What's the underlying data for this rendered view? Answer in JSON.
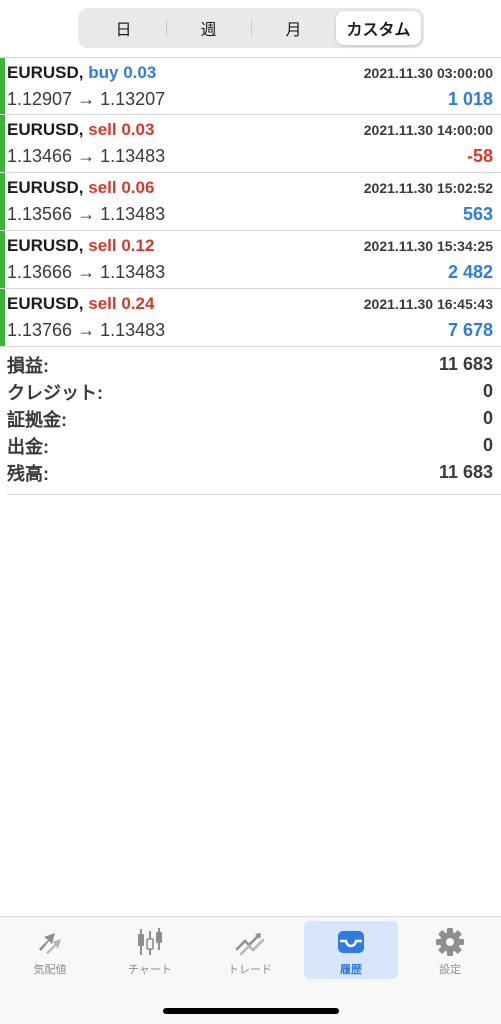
{
  "period_tabs": [
    {
      "label": "日",
      "active": false
    },
    {
      "label": "週",
      "active": false
    },
    {
      "label": "月",
      "active": false
    },
    {
      "label": "カスタム",
      "active": true
    }
  ],
  "deals": [
    {
      "symbol": "EURUSD,",
      "side": "buy 0.03",
      "time": "2021.11.30 03:00:00",
      "prices": "1.12907 → 1.13207",
      "profit": "1 018",
      "profit_sign": "pos"
    },
    {
      "symbol": "EURUSD,",
      "side": "sell 0.03",
      "time": "2021.11.30 14:00:00",
      "prices": "1.13466 → 1.13483",
      "profit": "-58",
      "profit_sign": "neg"
    },
    {
      "symbol": "EURUSD,",
      "side": "sell 0.06",
      "time": "2021.11.30 15:02:52",
      "prices": "1.13566 → 1.13483",
      "profit": "563",
      "profit_sign": "pos"
    },
    {
      "symbol": "EURUSD,",
      "side": "sell 0.12",
      "time": "2021.11.30 15:34:25",
      "prices": "1.13666 → 1.13483",
      "profit": "2 482",
      "profit_sign": "pos"
    },
    {
      "symbol": "EURUSD,",
      "side": "sell 0.24",
      "time": "2021.11.30 16:45:43",
      "prices": "1.13766 → 1.13483",
      "profit": "7 678",
      "profit_sign": "pos"
    }
  ],
  "summary": [
    {
      "label": "損益:",
      "value": "11 683"
    },
    {
      "label": "クレジット:",
      "value": "0"
    },
    {
      "label": "証拠金:",
      "value": "0"
    },
    {
      "label": "出金:",
      "value": "0"
    },
    {
      "label": "残高:",
      "value": "11 683"
    }
  ],
  "tabbar": [
    {
      "label": "気配値",
      "icon": "quotes-icon",
      "active": false
    },
    {
      "label": "チャート",
      "icon": "candlestick-chart-icon",
      "active": false
    },
    {
      "label": "トレード",
      "icon": "trade-icon",
      "active": false
    },
    {
      "label": "履歴",
      "icon": "history-inbox-icon",
      "active": true
    },
    {
      "label": "設定",
      "icon": "gear-icon",
      "active": false
    }
  ],
  "colors": {
    "accent": "#2f7be0",
    "loss": "#d43b2f",
    "deal_bar": "#3cb43c"
  }
}
